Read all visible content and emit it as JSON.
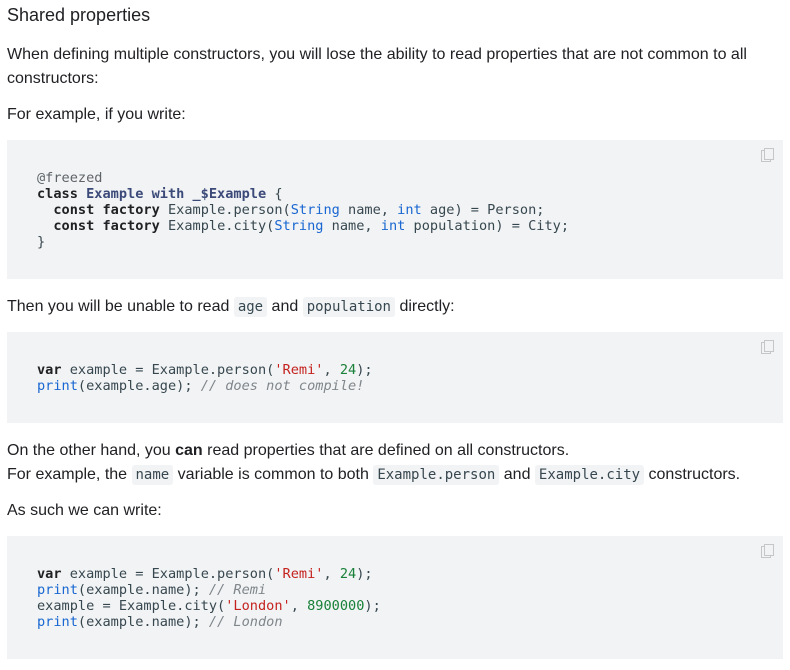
{
  "heading": "Shared properties",
  "intro": "When defining multiple constructors, you will lose the ability to read properties that are not common to all constructors:",
  "example_intro": "For example, if you write:",
  "code1": {
    "l1": "@freezed",
    "l2_kw": "class",
    "l2_name": "Example with _$Example",
    "l2_rest": " {",
    "l3_kw": "const factory",
    "l3_a": " Example.person(",
    "l3_t1": "String",
    "l3_b": " name, ",
    "l3_t2": "int",
    "l3_c": " age) = Person;",
    "l4_kw": "const factory",
    "l4_a": " Example.city(",
    "l4_t1": "String",
    "l4_b": " name, ",
    "l4_t2": "int",
    "l4_c": " population) = City;",
    "l5": "}"
  },
  "unable": {
    "pre": "Then you will be unable to read ",
    "code_a": "age",
    "mid": " and ",
    "code_b": "population",
    "post": " directly:"
  },
  "code2": {
    "l1_kw": "var",
    "l1_a": " example = Example.person(",
    "l1_str": "'Remi'",
    "l1_b": ", ",
    "l1_num": "24",
    "l1_c": ");",
    "l2_fn": "print",
    "l2_a": "(example.age); ",
    "l2_com": "// does not compile!"
  },
  "other_hand": {
    "pre": "On the other hand, you ",
    "bold": "can",
    "post": " read properties that are defined on all constructors."
  },
  "common": {
    "pre": "For example, the ",
    "code_a": "name",
    "mid1": " variable is common to both ",
    "code_b": "Example.person",
    "mid2": " and ",
    "code_c": "Example.city",
    "post": " constructors."
  },
  "as_such": "As such we can write:",
  "code3": {
    "l1_kw": "var",
    "l1_a": " example = Example.person(",
    "l1_str": "'Remi'",
    "l1_b": ", ",
    "l1_num": "24",
    "l1_c": ");",
    "l2_fn": "print",
    "l2_a": "(example.name); ",
    "l2_com": "// Remi",
    "l3_a": "example = Example.city(",
    "l3_str": "'London'",
    "l3_b": ", ",
    "l3_num": "8900000",
    "l3_c": ");",
    "l4_fn": "print",
    "l4_a": "(example.name); ",
    "l4_com": "// London"
  },
  "icons": {
    "copy": "copy-icon"
  },
  "colors": {
    "code_bg": "#f1f3f4",
    "type": "#1967d2",
    "string": "#c5221f",
    "number": "#188038",
    "comment": "#80868b"
  }
}
